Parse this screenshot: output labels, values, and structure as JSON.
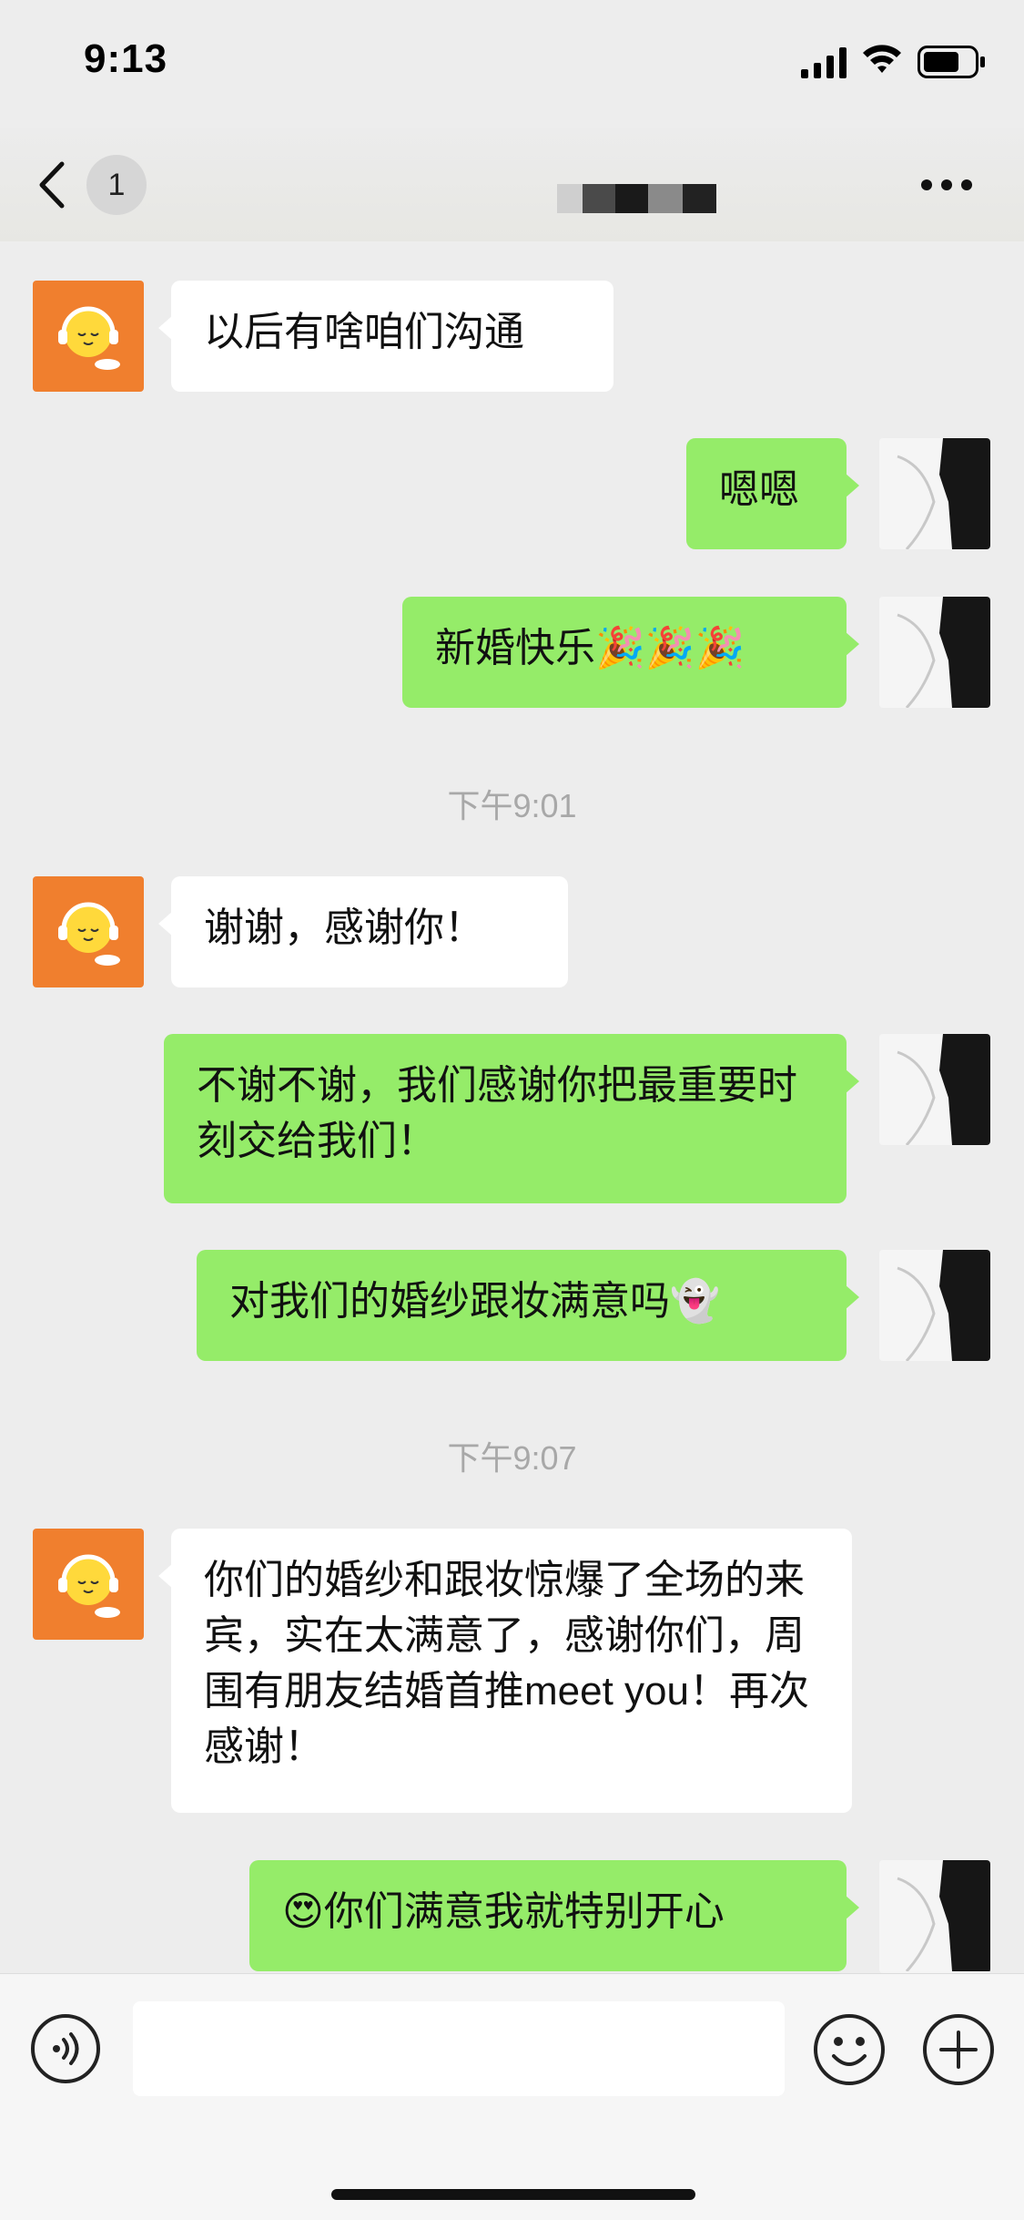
{
  "status_bar": {
    "time": "9:13"
  },
  "nav": {
    "unread_count": "1"
  },
  "messages": [
    {
      "text": "以后有啥咱们沟通"
    },
    {
      "text": "嗯嗯"
    },
    {
      "text": "新婚快乐🎉🎉🎉"
    },
    {
      "text": "谢谢，感谢你！"
    },
    {
      "text": "不谢不谢，我们感谢你把最重要时刻交给我们！"
    },
    {
      "text": "对我们的婚纱跟妆满意吗👻"
    },
    {
      "text": "你们的婚纱和跟妆惊爆了全场的来宾，实在太满意了，感谢你们，周围有朋友结婚首推meet you！再次感谢！"
    },
    {
      "text": "😍你们满意我就特别开心"
    }
  ],
  "timestamps": [
    "下午9:01",
    "下午9:07"
  ],
  "colors": {
    "sent_bubble": "#95ec69",
    "received_bubble": "#ffffff",
    "background": "#ededed",
    "avatar": "#f07f2e"
  },
  "icons": [
    "back-chevron-icon",
    "more-icon",
    "voice-icon",
    "emoji-icon",
    "plus-icon",
    "signal-icon",
    "wifi-icon",
    "battery-icon"
  ]
}
